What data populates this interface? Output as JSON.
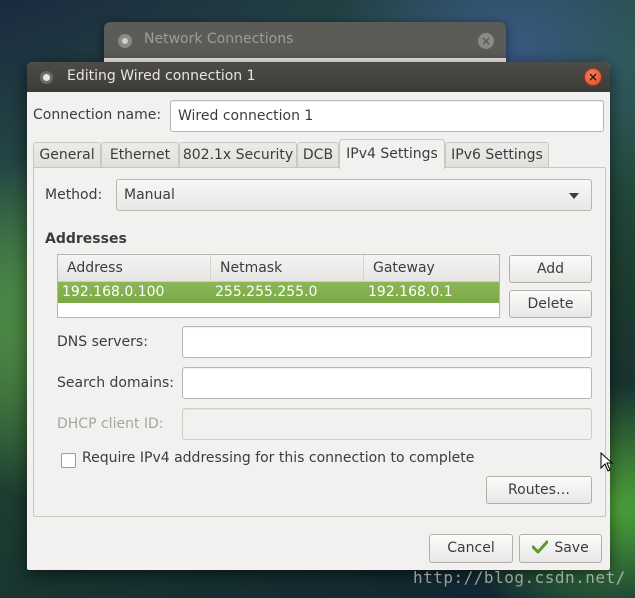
{
  "background_window": {
    "title": "Network Connections"
  },
  "dialog": {
    "title": "Editing Wired connection 1",
    "connection_name_label": "Connection name:",
    "connection_name_value": "Wired connection 1",
    "tabs": [
      {
        "label": "General",
        "active": false
      },
      {
        "label": "Ethernet",
        "active": false
      },
      {
        "label": "802.1x Security",
        "active": false
      },
      {
        "label": "DCB",
        "active": false
      },
      {
        "label": "IPv4 Settings",
        "active": true
      },
      {
        "label": "IPv6 Settings",
        "active": false
      }
    ],
    "ipv4": {
      "method_label": "Method:",
      "method_value": "Manual",
      "addresses_title": "Addresses",
      "columns": [
        "Address",
        "Netmask",
        "Gateway"
      ],
      "rows": [
        {
          "address": "192.168.0.100",
          "netmask": "255.255.255.0",
          "gateway": "192.168.0.1",
          "selected": true
        }
      ],
      "add_label": "Add",
      "delete_label": "Delete",
      "dns_label": "DNS servers:",
      "dns_value": "",
      "search_domains_label": "Search domains:",
      "search_domains_value": "",
      "dhcp_client_id_label": "DHCP client ID:",
      "dhcp_client_id_value": "",
      "require_checkbox_label": "Require IPv4 addressing for this connection to complete",
      "require_checked": false,
      "routes_label": "Routes…"
    },
    "cancel_label": "Cancel",
    "save_label": "Save"
  },
  "watermark": "http://blog.csdn.net/",
  "colors": {
    "selection": "#7aa845",
    "close_button": "#e04b20",
    "titlebar": "#3c3b37"
  }
}
